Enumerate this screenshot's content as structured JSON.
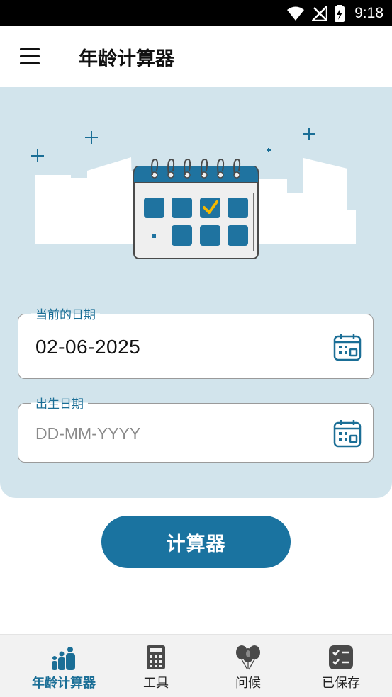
{
  "status_bar": {
    "time": "9:18"
  },
  "app_bar": {
    "title": "年龄计算器"
  },
  "current_date": {
    "label": "当前的日期",
    "value": "02-06-2025"
  },
  "birth_date": {
    "label": "出生日期",
    "value": "",
    "placeholder": "DD-MM-YYYY"
  },
  "calculate_button": {
    "label": "计算器"
  },
  "bottom_nav": {
    "items": [
      {
        "label": "年龄计算器",
        "icon": "family-icon",
        "active": true
      },
      {
        "label": "工具",
        "icon": "calculator-icon",
        "active": false
      },
      {
        "label": "问候",
        "icon": "balloons-icon",
        "active": false
      },
      {
        "label": "已保存",
        "icon": "checklist-icon",
        "active": false
      }
    ]
  },
  "colors": {
    "accent": "#1a73a0",
    "panel": "#d2e4ec",
    "label": "#1a6e96",
    "check": "#f5b800"
  }
}
